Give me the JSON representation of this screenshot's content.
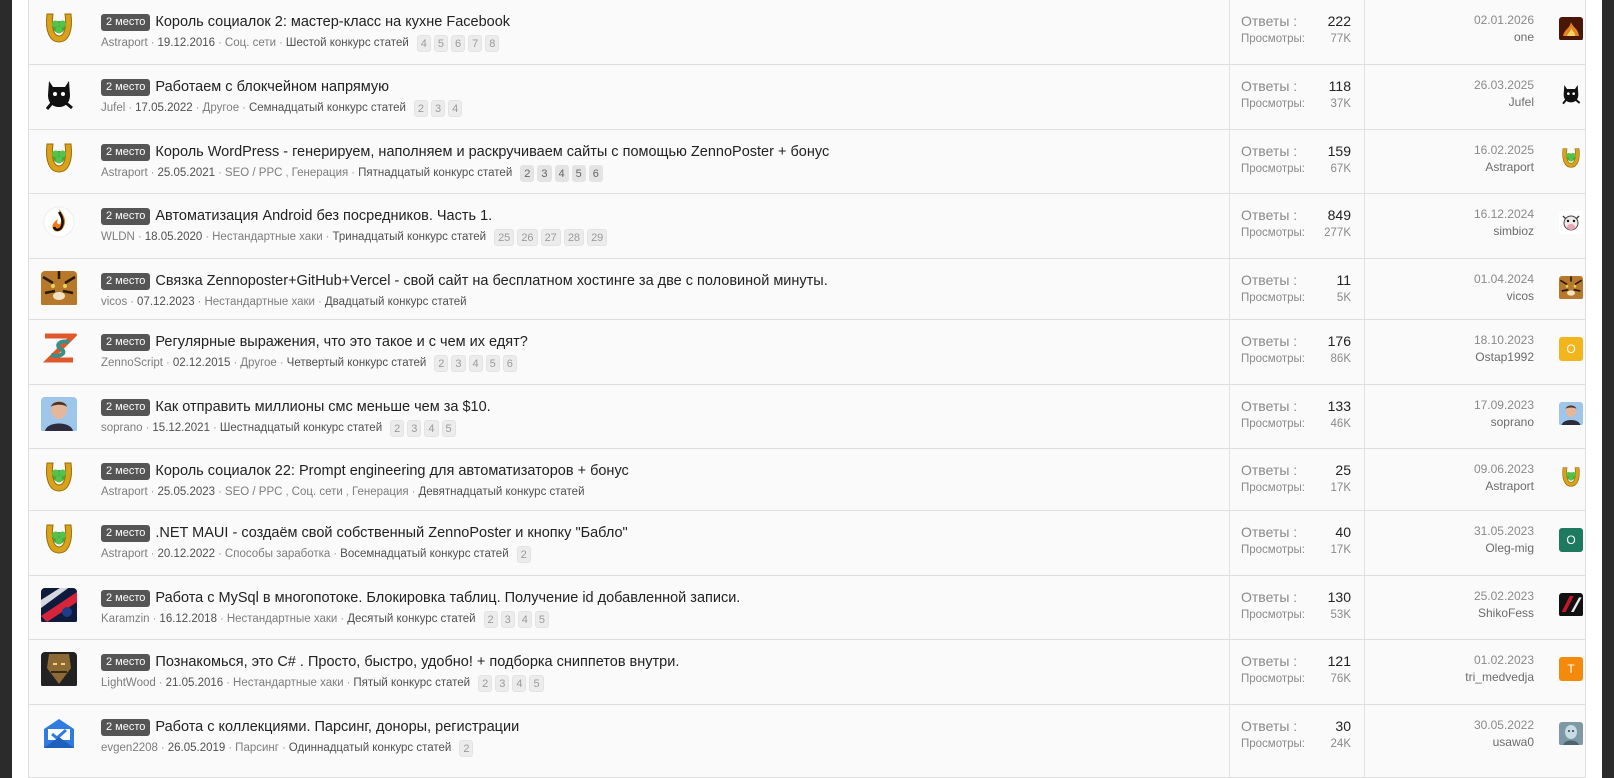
{
  "topics": [
    {
      "badge": "2 место",
      "title": "Король социалок 2: мастер-класс на кухне Facebook",
      "author": "Astraport",
      "date": "19.12.2016",
      "forums": [
        "Соц. сети"
      ],
      "contest": "Шестой конкурс статей",
      "pages": [
        "4",
        "5",
        "6",
        "7",
        "8"
      ],
      "pages_dark": false,
      "replies_label": "Ответы :",
      "replies": "222",
      "views_label": "Просмотры:",
      "views": "77K",
      "last_date": "02.01.2026",
      "last_user": "one",
      "avatar_icon": "horseshoe-clover-icon",
      "last_avatar_icon": "fire-avatar-icon",
      "last_letter": ""
    },
    {
      "badge": "2 место",
      "title": "Работаем с блокчейном напрямую",
      "author": "Jufel",
      "date": "17.05.2022",
      "forums": [
        "Другое"
      ],
      "contest": "Семнадцатый конкурс статей",
      "pages": [
        "2",
        "3",
        "4"
      ],
      "pages_dark": false,
      "replies_label": "Ответы :",
      "replies": "118",
      "views_label": "Просмотры:",
      "views": "37K",
      "last_date": "26.03.2025",
      "last_user": "Jufel",
      "avatar_icon": "black-cat-icon",
      "last_avatar_icon": "black-cat-icon",
      "last_letter": ""
    },
    {
      "badge": "2 место",
      "title": "Король WordPress - генерируем, наполняем и раскручиваем сайты с помощью ZennoPoster + бонус",
      "author": "Astraport",
      "date": "25.05.2021",
      "forums": [
        "SEO / PPC",
        "Генерация"
      ],
      "contest": "Пятнадцатый конкурс статей",
      "pages": [
        "2",
        "3",
        "4",
        "5",
        "6"
      ],
      "pages_dark": true,
      "replies_label": "Ответы :",
      "replies": "159",
      "views_label": "Просмотры:",
      "views": "67K",
      "last_date": "16.02.2025",
      "last_user": "Astraport",
      "avatar_icon": "horseshoe-clover-icon",
      "last_avatar_icon": "horseshoe-clover-icon",
      "last_letter": ""
    },
    {
      "badge": "2 место",
      "title": "Автоматизация Android без посредников. Часть 1.",
      "author": "WLDN",
      "date": "18.05.2020",
      "forums": [
        "Нестандартные хаки"
      ],
      "contest": "Тринадцатый конкурс статей",
      "pages": [
        "25",
        "26",
        "27",
        "28",
        "29"
      ],
      "pages_dark": false,
      "replies_label": "Ответы :",
      "replies": "849",
      "views_label": "Просмотры:",
      "views": "277K",
      "last_date": "16.12.2024",
      "last_user": "simbioz",
      "avatar_icon": "flame-logo-icon",
      "last_avatar_icon": "cow-avatar-icon",
      "last_letter": ""
    },
    {
      "badge": "2 место",
      "title": "Связка Zennoposter+GitHub+Vercel - свой сайт на бесплатном хостинге за две с половиной минуты.",
      "author": "vicos",
      "date": "07.12.2023",
      "forums": [
        "Нестандартные хаки"
      ],
      "contest": "Двадцатый конкурс статей",
      "pages": [],
      "pages_dark": false,
      "replies_label": "Ответы :",
      "replies": "11",
      "views_label": "Просмотры:",
      "views": "5K",
      "last_date": "01.04.2024",
      "last_user": "vicos",
      "avatar_icon": "tiger-avatar-icon",
      "last_avatar_icon": "tiger-avatar-icon",
      "last_letter": ""
    },
    {
      "badge": "2 место",
      "title": "Регулярные выражения, что это такое и с чем их едят?",
      "author": "ZennoScript",
      "date": "02.12.2015",
      "forums": [
        "Другое"
      ],
      "contest": "Четвертый конкурс статей",
      "pages": [
        "2",
        "3",
        "4",
        "5",
        "6"
      ],
      "pages_dark": false,
      "replies_label": "Ответы :",
      "replies": "176",
      "views_label": "Просмотры:",
      "views": "86K",
      "last_date": "18.10.2023",
      "last_user": "Ostap1992",
      "avatar_icon": "zs-logo-icon",
      "last_avatar_icon": "letter-avatar-icon",
      "last_letter": "O"
    },
    {
      "badge": "2 место",
      "title": "Как отправить миллионы смс меньше чем за $10.",
      "author": "soprano",
      "date": "15.12.2021",
      "forums": [],
      "contest": "Шестнадцатый конкурс статей",
      "pages": [
        "2",
        "3",
        "4",
        "5"
      ],
      "pages_dark": false,
      "replies_label": "Ответы :",
      "replies": "133",
      "views_label": "Просмотры:",
      "views": "46K",
      "last_date": "17.09.2023",
      "last_user": "soprano",
      "avatar_icon": "man-photo-avatar-icon",
      "last_avatar_icon": "man-photo-avatar-icon",
      "last_letter": ""
    },
    {
      "badge": "2 место",
      "title": "Король социалок 22: Prompt engineering для автоматизаторов + бонус",
      "author": "Astraport",
      "date": "25.05.2023",
      "forums": [
        "SEO / PPC",
        "Соц. сети",
        "Генерация"
      ],
      "contest": "Девятнадцатый конкурс статей",
      "pages": [],
      "pages_dark": false,
      "replies_label": "Ответы :",
      "replies": "25",
      "views_label": "Просмотры:",
      "views": "17K",
      "last_date": "09.06.2023",
      "last_user": "Astraport",
      "avatar_icon": "horseshoe-clover-icon",
      "last_avatar_icon": "horseshoe-clover-icon",
      "last_letter": ""
    },
    {
      "badge": "2 место",
      "title": ".NET MAUI - создаём свой собственный ZennoPoster и кнопку \"Бабло\"",
      "author": "Astraport",
      "date": "20.12.2022",
      "forums": [
        "Способы заработка"
      ],
      "contest": "Восемнадцатый конкурс статей",
      "pages": [
        "2"
      ],
      "pages_dark": false,
      "replies_label": "Ответы :",
      "replies": "40",
      "views_label": "Просмотры:",
      "views": "17K",
      "last_date": "31.05.2023",
      "last_user": "Oleg-mig",
      "avatar_icon": "horseshoe-clover-icon",
      "last_avatar_icon": "letter-avatar-icon",
      "last_letter": "O"
    },
    {
      "badge": "2 место",
      "title": "Работа с MySql в многопотоке. Блокировка таблиц. Получение id добавленной записи.",
      "author": "Karamzin",
      "date": "16.12.2018",
      "forums": [
        "Нестандартные хаки"
      ],
      "contest": "Десятый конкурс статей",
      "pages": [
        "2",
        "3",
        "4",
        "5"
      ],
      "pages_dark": false,
      "replies_label": "Ответы :",
      "replies": "130",
      "views_label": "Просмотры:",
      "views": "53K",
      "last_date": "25.02.2023",
      "last_user": "ShikoFess",
      "avatar_icon": "red-blue-avatar-icon",
      "last_avatar_icon": "red-black-avatar-icon",
      "last_letter": ""
    },
    {
      "badge": "2 место",
      "title": "Познакомься, это C# . Просто, быстро, удобно! + подборка сниппетов внутри.",
      "author": "LightWood",
      "date": "21.05.2016",
      "forums": [
        "Нестандартные хаки"
      ],
      "contest": "Пятый конкурс статей",
      "pages": [
        "2",
        "3",
        "4",
        "5"
      ],
      "pages_dark": false,
      "replies_label": "Ответы :",
      "replies": "121",
      "views_label": "Просмотры:",
      "views": "76K",
      "last_date": "01.02.2023",
      "last_user": "tri_medvedja",
      "avatar_icon": "warrior-avatar-icon",
      "last_avatar_icon": "letter-avatar-icon",
      "last_letter": "T"
    },
    {
      "badge": "2 место",
      "title": "Работа с коллекциями. Парсинг, доноры, регистрации",
      "author": "evgen2208",
      "date": "26.05.2019",
      "forums": [
        "Парсинг"
      ],
      "contest": "Одиннадцатый конкурс статей",
      "pages": [
        "2"
      ],
      "pages_dark": false,
      "replies_label": "Ответы :",
      "replies": "30",
      "views_label": "Просмотры:",
      "views": "24K",
      "last_date": "30.05.2022",
      "last_user": "usawa0",
      "avatar_icon": "inbox-check-icon",
      "last_avatar_icon": "photo-avatar-icon",
      "last_letter": ""
    }
  ],
  "colors": {
    "badge_bg": "#555555",
    "letter_avatar_O1": "#f2b51d",
    "letter_avatar_O2": "#1d7a5e",
    "letter_avatar_T": "#f48a0c"
  }
}
